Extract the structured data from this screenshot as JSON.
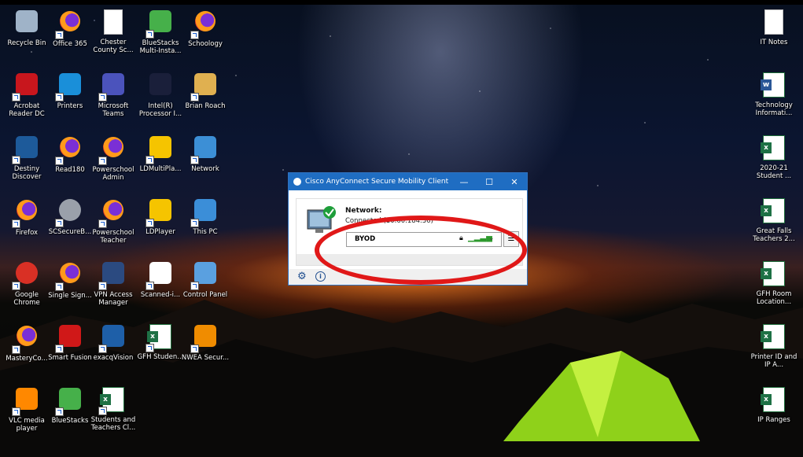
{
  "desktop": {
    "icons_left": [
      {
        "label": "Recycle Bin",
        "icon": "recycle-bin-icon"
      },
      {
        "label": "Office 365",
        "icon": "firefox-shortcut-icon"
      },
      {
        "label": "Chester County Sc...",
        "icon": "blank-document-icon"
      },
      {
        "label": "BlueStacks Multi-Insta...",
        "icon": "bluestacks-multi-icon"
      },
      {
        "label": "Schoology",
        "icon": "firefox-shortcut-icon"
      },
      {
        "label": "Acrobat Reader DC",
        "icon": "acrobat-icon"
      },
      {
        "label": "Printers",
        "icon": "internet-explorer-icon"
      },
      {
        "label": "Microsoft Teams",
        "icon": "teams-icon"
      },
      {
        "label": "Intel(R) Processor I...",
        "icon": "intel-processor-icon"
      },
      {
        "label": "Brian Roach",
        "icon": "user-folder-icon"
      },
      {
        "label": "Destiny Discover",
        "icon": "destiny-icon"
      },
      {
        "label": "Read180",
        "icon": "firefox-shortcut-icon"
      },
      {
        "label": "Powerschool Admin",
        "icon": "firefox-shortcut-icon"
      },
      {
        "label": "LDMultiPla...",
        "icon": "ldmultiplayer-icon"
      },
      {
        "label": "Network",
        "icon": "network-icon"
      },
      {
        "label": "Firefox",
        "icon": "firefox-icon"
      },
      {
        "label": "SCSecureB...",
        "icon": "secure-browser-icon"
      },
      {
        "label": "Powerschool Teacher",
        "icon": "firefox-shortcut-icon"
      },
      {
        "label": "LDPlayer",
        "icon": "ldplayer-icon"
      },
      {
        "label": "This PC",
        "icon": "this-pc-icon"
      },
      {
        "label": "Google Chrome",
        "icon": "chrome-icon"
      },
      {
        "label": "Single Sign...",
        "icon": "firefox-shortcut-icon"
      },
      {
        "label": "VPN Access Manager",
        "icon": "vpn-lock-icon"
      },
      {
        "label": "Scanned-i...",
        "icon": "pdf-file-icon"
      },
      {
        "label": "Control Panel",
        "icon": "control-panel-icon"
      },
      {
        "label": "MasteryCo...",
        "icon": "firefox-shortcut-icon"
      },
      {
        "label": "Smart Fusion",
        "icon": "smart-fusion-icon"
      },
      {
        "label": "exacqVision",
        "icon": "exacqvision-icon"
      },
      {
        "label": "GFH Studen...",
        "icon": "excel-file-icon"
      },
      {
        "label": "NWEA Secur...",
        "icon": "nwea-icon"
      },
      {
        "label": "VLC media player",
        "icon": "vlc-icon"
      },
      {
        "label": "BlueStacks",
        "icon": "bluestacks-icon"
      },
      {
        "label": "Students and Teachers Cl...",
        "icon": "excel-file-icon"
      }
    ],
    "icons_right": [
      {
        "label": "IT Notes",
        "icon": "text-document-icon"
      },
      {
        "label": "Technology Informati...",
        "icon": "word-file-icon"
      },
      {
        "label": "2020-21 Student ...",
        "icon": "excel-file-icon"
      },
      {
        "label": "Great Falls Teachers 2...",
        "icon": "excel-file-icon"
      },
      {
        "label": "GFH Room Location...",
        "icon": "excel-file-icon"
      },
      {
        "label": "Printer ID and IP A...",
        "icon": "excel-file-icon"
      },
      {
        "label": "IP Ranges",
        "icon": "excel-file-icon"
      }
    ]
  },
  "cisco": {
    "title": "Cisco AnyConnect Secure Mobility Client",
    "minimize": "—",
    "maximize": "☐",
    "close": "✕",
    "network_heading": "Network:",
    "status": "Connected (10.60.184.36)",
    "selected_network": "BYOD",
    "accent_color": "#1f6dc2",
    "annotation_color": "#e01818"
  }
}
